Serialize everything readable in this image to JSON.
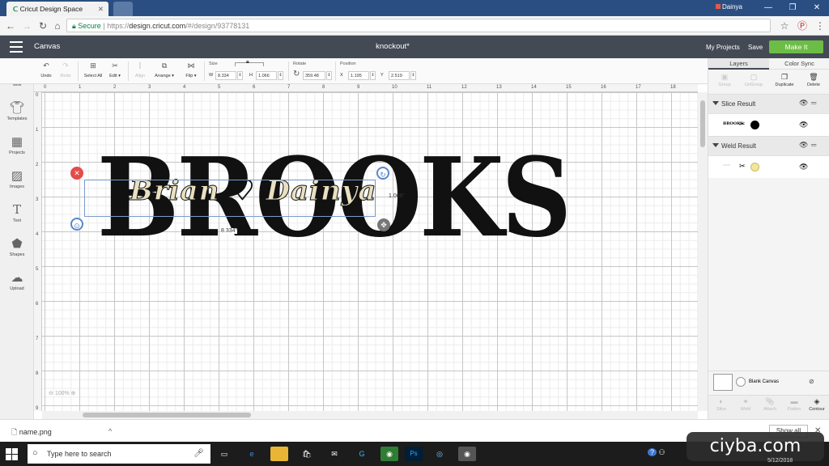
{
  "browser": {
    "tab_title": "Cricut Design Space",
    "profile": "Dainya",
    "secure_label": "Secure",
    "url_prefix": "https://",
    "url_host": "design.cricut.com",
    "url_path": "/#/design/93778131",
    "bookmark_icon": "star-icon",
    "pinterest_icon": "pinterest-icon"
  },
  "app_header": {
    "section": "Canvas",
    "doc_title": "knockout*",
    "my_projects": "My Projects",
    "save": "Save",
    "make": "Make It"
  },
  "toolbar": {
    "undo": "Undo",
    "redo": "Redo",
    "select_all": "Select All",
    "edit": "Edit",
    "align": "Align",
    "arrange": "Arrange",
    "flip": "Flip",
    "size_label": "Size",
    "w_cap": "W",
    "w_value": "8.334",
    "h_cap": "H",
    "h_value": "1.066",
    "rotate_label": "Rotate",
    "rotate_value": "359.48",
    "position_label": "Position",
    "x_cap": "X",
    "x_value": "1.195",
    "y_cap": "Y",
    "y_value": "2.519"
  },
  "left_sidebar": [
    {
      "label": "New",
      "icon": "plus-circle-icon"
    },
    {
      "label": "Templates",
      "icon": "shirt-icon"
    },
    {
      "label": "Projects",
      "icon": "projects-icon"
    },
    {
      "label": "Images",
      "icon": "image-icon"
    },
    {
      "label": "Text",
      "icon": "text-icon"
    },
    {
      "label": "Shapes",
      "icon": "shapes-icon"
    },
    {
      "label": "Upload",
      "icon": "cloud-upload-icon"
    }
  ],
  "rulers": {
    "top": [
      "0",
      "1",
      "2",
      "3",
      "4",
      "5",
      "6",
      "7",
      "8",
      "9",
      "10",
      "11",
      "12",
      "13",
      "14",
      "15",
      "16",
      "17",
      "18"
    ],
    "left": [
      "0",
      "1",
      "2",
      "3",
      "4",
      "5",
      "6",
      "7",
      "8",
      "9"
    ]
  },
  "canvas": {
    "main_text": "BROOKS",
    "script_text": "Brian ♡ Dainya",
    "width_dim": "8.334\"",
    "height_dim": "1.066\"",
    "zoom": "100%"
  },
  "layers_panel": {
    "tab_layers": "Layers",
    "tab_color_sync": "Color Sync",
    "actions": [
      "Group",
      "UnGroup",
      "Duplicate",
      "Delete"
    ],
    "groups": [
      {
        "title": "Slice Result",
        "swatch": "#000000",
        "thumb": "BROOKS"
      },
      {
        "title": "Weld Result",
        "swatch": "#f3e59a",
        "thumb": "~~~"
      }
    ],
    "blank_canvas": "Blank Canvas",
    "bottom_actions": [
      "Slice",
      "Weld",
      "Attach",
      "Flatten",
      "Contour"
    ]
  },
  "download_bar": {
    "file": "name.png",
    "show_all": "Show all"
  },
  "taskbar": {
    "search_placeholder": "Type here to search",
    "clock_date": "5/12/2018"
  },
  "watermark": "ciyba.com",
  "colors": {
    "header": "#434a54",
    "make_button": "#6cbd45",
    "selection": "#7a9bd1",
    "delete_handle": "#e54b4b"
  }
}
